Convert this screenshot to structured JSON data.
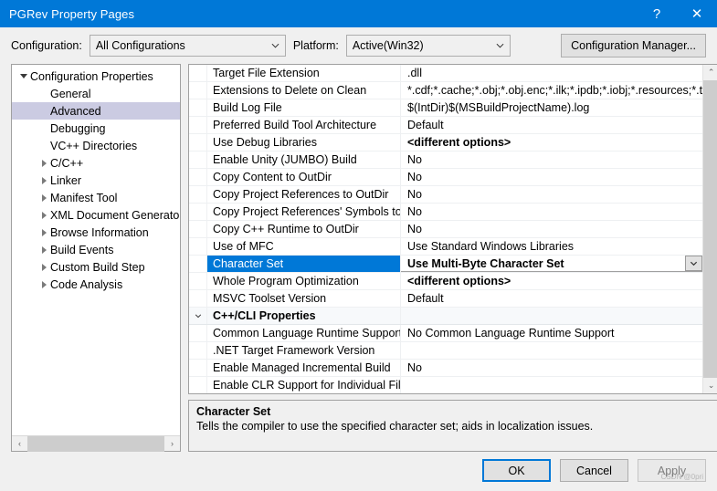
{
  "window": {
    "title": "PGRev Property Pages",
    "help_label": "?",
    "close_label": "✕"
  },
  "config_bar": {
    "configuration_label": "Configuration:",
    "configuration_value": "All Configurations",
    "platform_label": "Platform:",
    "platform_value": "Active(Win32)",
    "configuration_manager_label": "Configuration Manager..."
  },
  "tree": {
    "items": [
      {
        "label": "Configuration Properties",
        "indent": 0,
        "expander": "down",
        "selected": false
      },
      {
        "label": "General",
        "indent": 1,
        "expander": "none",
        "selected": false
      },
      {
        "label": "Advanced",
        "indent": 1,
        "expander": "none",
        "selected": true
      },
      {
        "label": "Debugging",
        "indent": 1,
        "expander": "none",
        "selected": false
      },
      {
        "label": "VC++ Directories",
        "indent": 1,
        "expander": "none",
        "selected": false
      },
      {
        "label": "C/C++",
        "indent": 1,
        "expander": "right",
        "selected": false
      },
      {
        "label": "Linker",
        "indent": 1,
        "expander": "right",
        "selected": false
      },
      {
        "label": "Manifest Tool",
        "indent": 1,
        "expander": "right",
        "selected": false
      },
      {
        "label": "XML Document Generator",
        "indent": 1,
        "expander": "right",
        "selected": false
      },
      {
        "label": "Browse Information",
        "indent": 1,
        "expander": "right",
        "selected": false
      },
      {
        "label": "Build Events",
        "indent": 1,
        "expander": "right",
        "selected": false
      },
      {
        "label": "Custom Build Step",
        "indent": 1,
        "expander": "right",
        "selected": false
      },
      {
        "label": "Code Analysis",
        "indent": 1,
        "expander": "right",
        "selected": false
      }
    ],
    "hscroll": {
      "left_arrow": "‹",
      "right_arrow": "›"
    }
  },
  "grid": {
    "rows": [
      {
        "name": "Target File Extension",
        "value": ".dll",
        "type": "prop"
      },
      {
        "name": "Extensions to Delete on Clean",
        "value": "*.cdf;*.cache;*.obj;*.obj.enc;*.ilk;*.ipdb;*.iobj;*.resources;*.t",
        "type": "prop"
      },
      {
        "name": "Build Log File",
        "value": "$(IntDir)$(MSBuildProjectName).log",
        "type": "prop"
      },
      {
        "name": "Preferred Build Tool Architecture",
        "value": "Default",
        "type": "prop"
      },
      {
        "name": "Use Debug Libraries",
        "value": "<different options>",
        "type": "prop",
        "value_bold": true
      },
      {
        "name": "Enable Unity (JUMBO) Build",
        "value": "No",
        "type": "prop"
      },
      {
        "name": "Copy Content to OutDir",
        "value": "No",
        "type": "prop"
      },
      {
        "name": "Copy Project References to OutDir",
        "value": "No",
        "type": "prop"
      },
      {
        "name": "Copy Project References' Symbols to Ou",
        "value": "No",
        "type": "prop"
      },
      {
        "name": "Copy C++ Runtime to OutDir",
        "value": "No",
        "type": "prop"
      },
      {
        "name": "Use of MFC",
        "value": "Use Standard Windows Libraries",
        "type": "prop"
      },
      {
        "name": "Character Set",
        "value": "Use Multi-Byte Character Set",
        "type": "prop",
        "selected": true,
        "has_dropdown": true
      },
      {
        "name": "Whole Program Optimization",
        "value": "<different options>",
        "type": "prop",
        "value_bold": true
      },
      {
        "name": "MSVC Toolset Version",
        "value": "Default",
        "type": "prop"
      },
      {
        "name": "C++/CLI Properties",
        "value": "",
        "type": "group",
        "expander": "down"
      },
      {
        "name": "Common Language Runtime Support",
        "value": "No Common Language Runtime Support",
        "type": "prop"
      },
      {
        "name": ".NET Target Framework Version",
        "value": "",
        "type": "prop"
      },
      {
        "name": "Enable Managed Incremental Build",
        "value": "No",
        "type": "prop"
      },
      {
        "name": "Enable CLR Support for Individual Files",
        "value": "",
        "type": "prop"
      }
    ],
    "vscroll": {
      "up_arrow": "⌃",
      "down_arrow": "⌄"
    }
  },
  "description": {
    "title": "Character Set",
    "text": "Tells the compiler to use the specified character set; aids in localization issues."
  },
  "footer": {
    "ok_label": "OK",
    "cancel_label": "Cancel",
    "apply_label": "Apply",
    "watermark": "CSDN @0pri"
  },
  "colors": {
    "titlebar": "#0078d7",
    "selection": "#0078d7",
    "tree_selection": "#cbcbe2",
    "dialog_bg": "#f0f0f0"
  }
}
